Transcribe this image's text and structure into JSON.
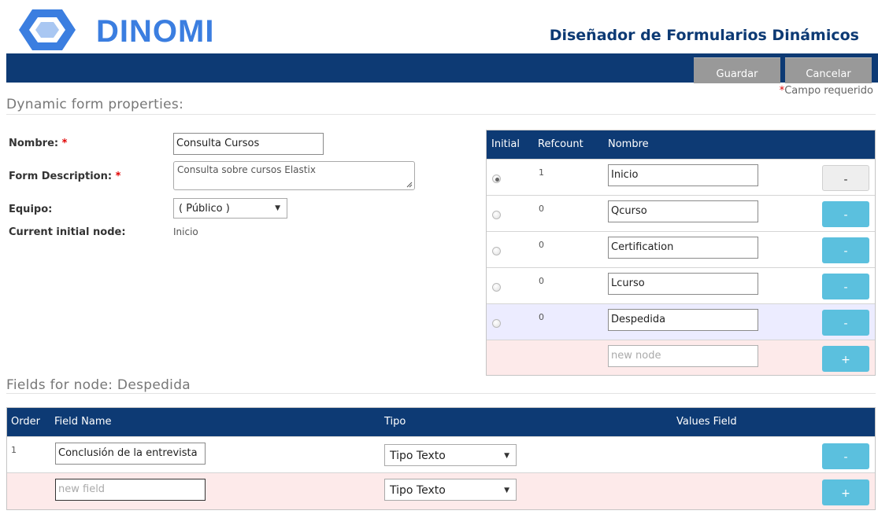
{
  "header": {
    "logo_text": "DINOMI",
    "app_title": "Diseñador de Formularios Dinámicos",
    "save_label": "Guardar",
    "cancel_label": "Cancelar",
    "required_star": "*",
    "required_note": "Campo requerido"
  },
  "form": {
    "section_title": "Dynamic form properties:",
    "name_label": "Nombre:",
    "name_value": "Consulta Cursos",
    "description_label": "Form Description:",
    "description_value": "Consulta sobre cursos Elastix",
    "team_label": "Equipo:",
    "team_value": "( Público )",
    "initial_node_label": "Current initial node:",
    "initial_node_value": "Inicio",
    "required_star": "*"
  },
  "nodes": {
    "headers": {
      "initial": "Initial",
      "refcount": "Refcount",
      "name": "Nombre"
    },
    "rows": [
      {
        "refcount": "1",
        "name": "Inicio",
        "button": "-",
        "checked": true
      },
      {
        "refcount": "0",
        "name": "Qcurso",
        "button": "-"
      },
      {
        "refcount": "0",
        "name": "Certification",
        "button": "-"
      },
      {
        "refcount": "0",
        "name": "Lcurso",
        "button": "-"
      },
      {
        "refcount": "0",
        "name": "Despedida",
        "button": "-"
      }
    ],
    "new_placeholder": "new node",
    "add_button": "+"
  },
  "fields": {
    "section_title": "Fields for node: Despedida",
    "headers": {
      "order": "Order",
      "field_name": "Field Name",
      "type": "Tipo",
      "values_field": "Values Field"
    },
    "rows": [
      {
        "order": "1",
        "field_name": "Conclusión de la entrevista",
        "type": "Tipo Texto",
        "button": "-"
      }
    ],
    "new_placeholder": "new field",
    "new_type": "Tipo Texto",
    "add_button": "+"
  },
  "colors": {
    "navy": "#0d3a74",
    "accent_blue": "#5bc0de",
    "required_red": "#e10000",
    "new_row_bg": "#fdeaea",
    "selected_row_bg": "#ececff"
  }
}
